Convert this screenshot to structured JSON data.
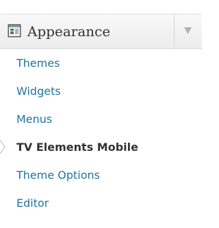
{
  "menu": {
    "title": "Appearance",
    "icon": "appearance-icon",
    "toggle_icon": "dropdown-arrow-icon",
    "items": [
      {
        "label": "Themes",
        "current": false
      },
      {
        "label": "Widgets",
        "current": false
      },
      {
        "label": "Menus",
        "current": false
      },
      {
        "label": "TV Elements Mobile",
        "current": true
      },
      {
        "label": "Theme Options",
        "current": false
      },
      {
        "label": "Editor",
        "current": false
      }
    ]
  },
  "colors": {
    "link": "#21759b",
    "current_text": "#333333",
    "title_text": "#333333",
    "header_bg": "#f1f1f1"
  }
}
